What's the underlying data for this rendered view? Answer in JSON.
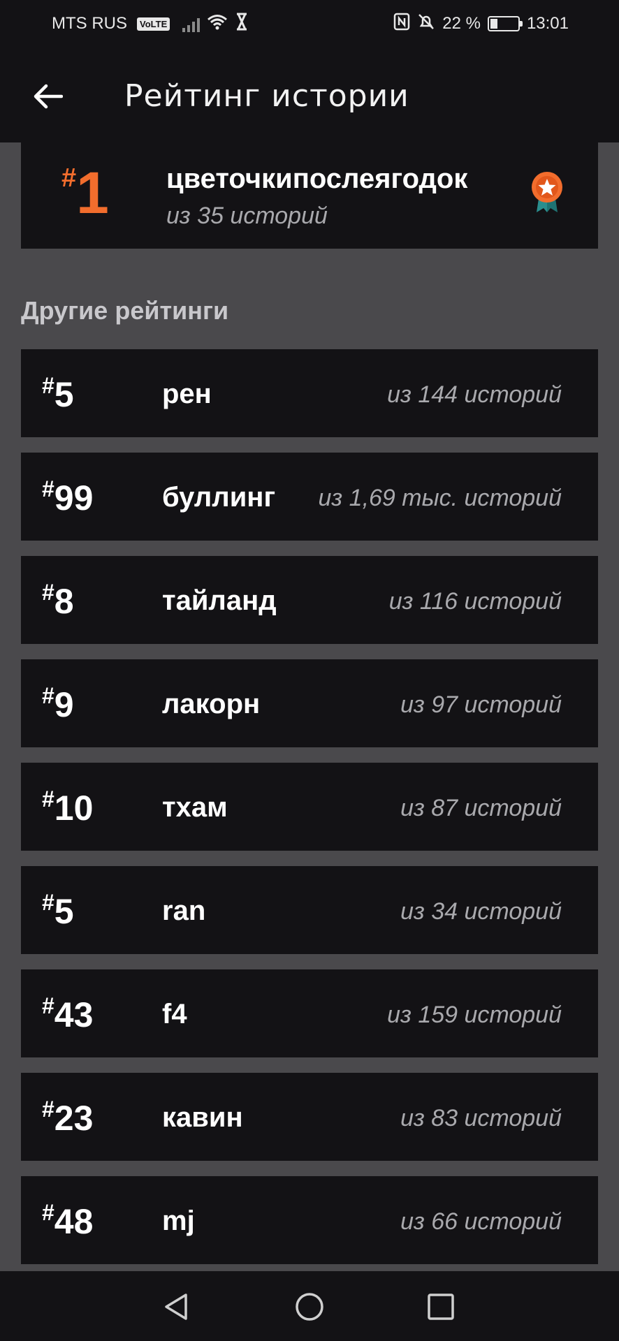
{
  "status_bar": {
    "carrier": "MTS RUS",
    "volte": "VoLTE",
    "battery_percent": "22 %",
    "time": "13:01"
  },
  "app_bar": {
    "title": "Рейтинг истории"
  },
  "top_rating": {
    "hash": "#",
    "rank": "1",
    "tag": "цветочкипослеягодок",
    "count": "из 35 историй",
    "accent_color": "#f26d2d"
  },
  "section": {
    "title": "Другие рейтинги"
  },
  "ratings": [
    {
      "hash": "#",
      "rank": "5",
      "tag": "рен",
      "count": "из 144 историй"
    },
    {
      "hash": "#",
      "rank": "99",
      "tag": "буллинг",
      "count": "из 1,69 тыс. историй"
    },
    {
      "hash": "#",
      "rank": "8",
      "tag": "тайланд",
      "count": "из 116 историй"
    },
    {
      "hash": "#",
      "rank": "9",
      "tag": "лакорн",
      "count": "из 97 историй"
    },
    {
      "hash": "#",
      "rank": "10",
      "tag": "тхам",
      "count": "из 87 историй"
    },
    {
      "hash": "#",
      "rank": "5",
      "tag": "ran",
      "count": "из 34 историй"
    },
    {
      "hash": "#",
      "rank": "43",
      "tag": "f4",
      "count": "из 159 историй"
    },
    {
      "hash": "#",
      "rank": "23",
      "tag": "кавин",
      "count": "из 83 историй"
    },
    {
      "hash": "#",
      "rank": "48",
      "tag": "mj",
      "count": "из 66 историй"
    }
  ],
  "icons": {
    "back": "arrow-left-icon",
    "award": "award-ribbon-icon",
    "nav": [
      "triangle-back-icon",
      "circle-home-icon",
      "square-recents-icon"
    ]
  }
}
